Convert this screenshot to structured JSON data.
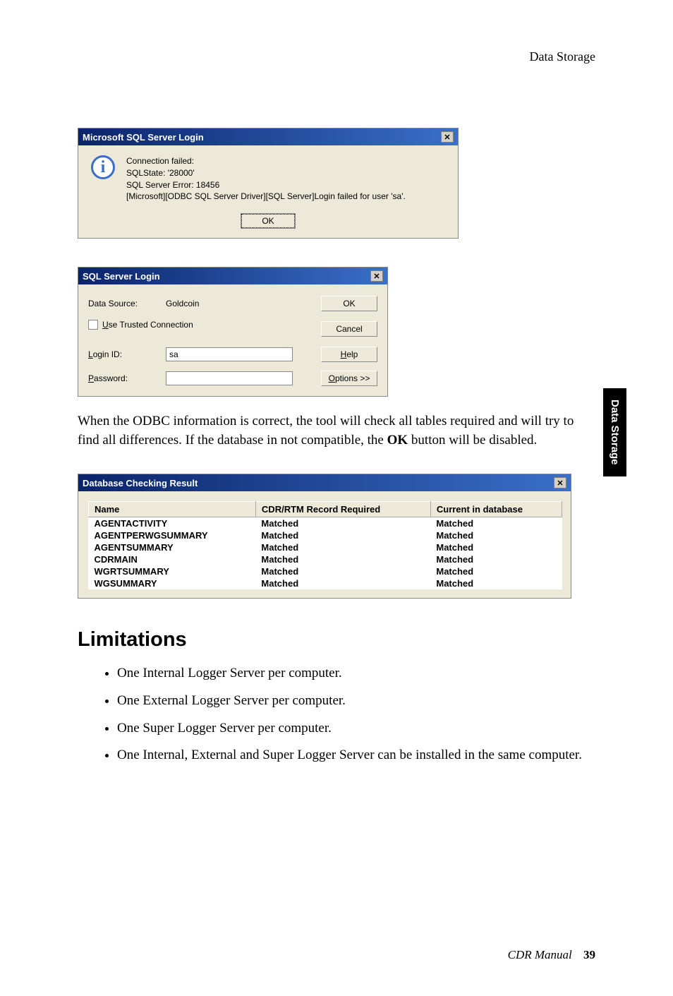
{
  "header": {
    "title": "Data Storage"
  },
  "sideTab": {
    "label": "Data Storage"
  },
  "dlg1": {
    "title": "Microsoft SQL Server Login",
    "line1": "Connection failed:",
    "line2": "SQLState: '28000'",
    "line3": "SQL Server Error: 18456",
    "line4": "[Microsoft][ODBC SQL Server Driver][SQL Server]Login failed for user 'sa'.",
    "ok": "OK"
  },
  "dlg2": {
    "title": "SQL Server Login",
    "dataSourceLabel": "Data Source:",
    "dataSourceValue": "Goldcoin",
    "trustedPre": "U",
    "trustedRest": "se Trusted Connection",
    "loginPre": "L",
    "loginRest": "ogin ID:",
    "loginValue": "sa",
    "passPre": "P",
    "passRest": "assword:",
    "passValue": "",
    "ok": "OK",
    "cancel": "Cancel",
    "helpPre": "H",
    "helpRest": "elp",
    "optPre": "O",
    "optRest": "ptions >>"
  },
  "bodyPara": {
    "p1": "When the ODBC information is correct, the tool will check all tables required and will try to find all differences. If the database in not compatible, the ",
    "bold": "OK",
    "p2": " button will be disabled."
  },
  "dlg3": {
    "title": "Database Checking Result",
    "col1": "Name",
    "col2": "CDR/RTM Record Required",
    "col3": "Current in database",
    "rows": [
      {
        "name": "AGENTACTIVITY",
        "req": "Matched",
        "cur": "Matched"
      },
      {
        "name": "AGENTPERWGSUMMARY",
        "req": "Matched",
        "cur": "Matched"
      },
      {
        "name": "AGENTSUMMARY",
        "req": "Matched",
        "cur": "Matched"
      },
      {
        "name": "CDRMAIN",
        "req": "Matched",
        "cur": "Matched"
      },
      {
        "name": "WGRTSUMMARY",
        "req": "Matched",
        "cur": "Matched"
      },
      {
        "name": "WGSUMMARY",
        "req": "Matched",
        "cur": "Matched"
      }
    ]
  },
  "limitations": {
    "heading": "Limitations",
    "items": [
      "One Internal Logger Server per computer.",
      "One External Logger Server per computer.",
      "One Super Logger Server per computer.",
      "One Internal, External and Super Logger Server can be installed in the same computer."
    ]
  },
  "footer": {
    "manual": "CDR Manual",
    "page": "39"
  }
}
